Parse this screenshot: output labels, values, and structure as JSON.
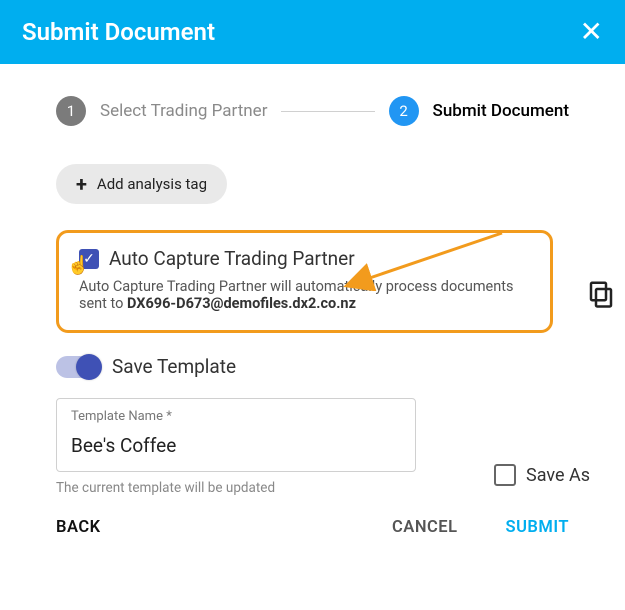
{
  "header": {
    "title": "Submit Document"
  },
  "stepper": {
    "step1": {
      "num": "1",
      "label": "Select Trading Partner"
    },
    "step2": {
      "num": "2",
      "label": "Submit Document"
    }
  },
  "add_tag": {
    "label": "Add analysis tag"
  },
  "auto_capture": {
    "label": "Auto Capture Trading Partner",
    "desc_prefix": "Auto Capture Trading Partner will automatically process documents sent to ",
    "email": "DX696-D673@demofiles.dx2.co.nz"
  },
  "save_template": {
    "label": "Save Template",
    "field_label": "Template Name *",
    "value": "Bee's Coffee",
    "help": "The current template will be updated"
  },
  "save_as": {
    "label": "Save As"
  },
  "actions": {
    "back": "BACK",
    "cancel": "CANCEL",
    "submit": "SUBMIT"
  }
}
